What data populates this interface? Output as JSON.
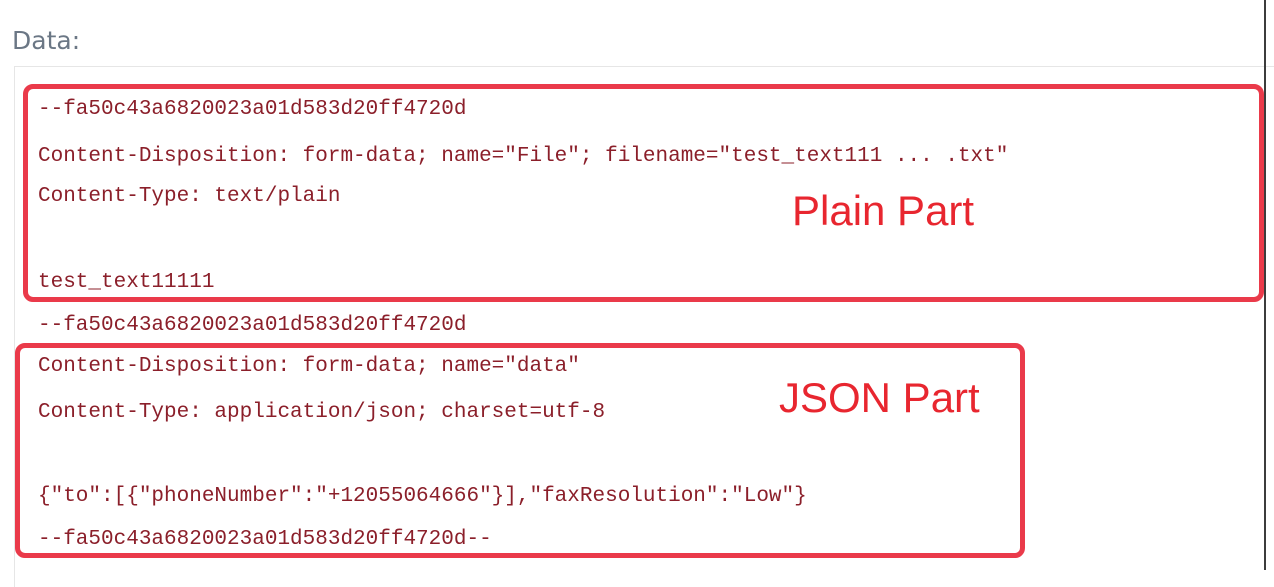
{
  "section_label": "Data:",
  "code_lines": [
    "--fa50c43a6820023a01d583d20ff4720d",
    "Content-Disposition: form-data; name=\"File\"; filename=\"test_text111 ... .txt\"",
    "Content-Type: text/plain",
    "",
    "test_text11111",
    "--fa50c43a6820023a01d583d20ff4720d",
    "Content-Disposition: form-data; name=\"data\"",
    "Content-Type: application/json; charset=utf-8",
    "",
    "{\"to\":[{\"phoneNumber\":\"+12055064666\"}],\"faxResolution\":\"Low\"}",
    "--fa50c43a6820023a01d583d20ff4720d--"
  ],
  "annotations": {
    "plain_part": "Plain Part",
    "json_part": "JSON Part"
  },
  "colors": {
    "code_text": "#8b1f2a",
    "highlight_border": "#ea3a4a",
    "annotation_text": "#e8262f",
    "label_text": "#6b7785"
  }
}
